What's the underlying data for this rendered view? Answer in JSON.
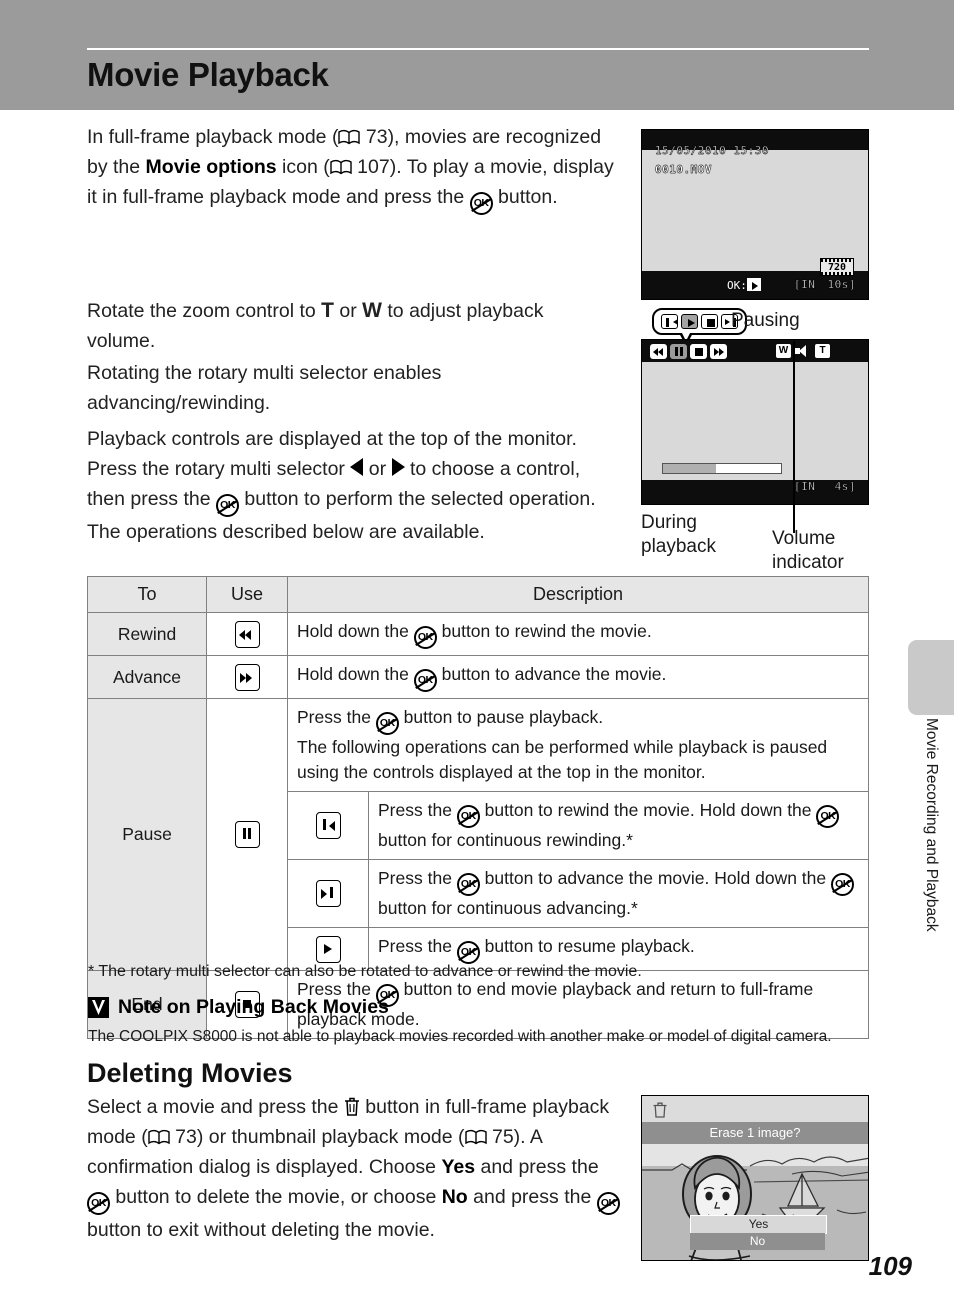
{
  "header": {
    "title": "Movie Playback"
  },
  "body": {
    "para_1_pre": "In full-frame playback mode (",
    "para_1_ref1": "73",
    "para_1_mid1": "), movies are recognized by the ",
    "para_1_bold": "Movie options",
    "para_1_mid2": " icon (",
    "para_1_ref2": "107",
    "para_1_mid3": "). To play a movie, display it in full-frame playback mode and press the ",
    "para_1_end": " button.",
    "para_2_a": "Rotate the zoom control to ",
    "para_2_t": "T",
    "para_2_b": " or ",
    "para_2_w": "W",
    "para_2_c": " to adjust playback volume.",
    "para_3": "Rotating the rotary multi selector enables advancing/rewinding.",
    "para_4_a": "Playback controls are displayed at the top of the monitor. Press the rotary multi selector ",
    "para_4_b": " or ",
    "para_4_c": " to choose a control, then press the ",
    "para_4_d": " button to perform the selected operation. The operations described below are available."
  },
  "screens": {
    "fullframe": {
      "datetime": "15/05/2010 15:30",
      "filename": "0010.MOV",
      "quality_badge": "720",
      "ok_label": "OK:",
      "memory": "[IN",
      "duration": "10s]"
    },
    "playing": {
      "memory": "[IN",
      "duration": "4s]",
      "zoom_wide": "W",
      "zoom_tele": "T",
      "progress_percent": 45,
      "controls": [
        "rewind",
        "pause",
        "stop",
        "advance"
      ]
    },
    "callout": {
      "label": "Pausing",
      "controls": [
        "step-rewind",
        "play",
        "stop",
        "step-advance"
      ]
    },
    "captions": {
      "during_playback": "During playback",
      "volume_indicator": "Volume indicator"
    },
    "erase_dialog": {
      "title": "Erase 1 image?",
      "yes": "Yes",
      "no": "No"
    }
  },
  "table": {
    "headers": [
      "To",
      "Use",
      "Description"
    ],
    "rows": [
      {
        "to": "Rewind",
        "icon": "rewind-icon",
        "desc_a": "Hold down the ",
        "desc_b": " button to rewind the movie."
      },
      {
        "to": "Advance",
        "icon": "advance-icon",
        "desc_a": "Hold down the ",
        "desc_b": " button to advance the movie."
      },
      {
        "to": "Pause",
        "icon": "pause-icon",
        "desc_line1_a": "Press the ",
        "desc_line1_b": " button to pause playback.",
        "desc_line2": "The following operations can be performed while playback is paused using the controls displayed at the top in the monitor.",
        "sub_rows": [
          {
            "icon": "step-rewind-icon",
            "a": "Press the ",
            "b": " button to rewind the movie. Hold down the ",
            "c": " button for continuous rewinding.*"
          },
          {
            "icon": "step-advance-icon",
            "a": "Press the ",
            "b": " button to advance the movie. Hold down the ",
            "c": " button for continuous advancing.*"
          },
          {
            "icon": "play-icon",
            "a": "Press the ",
            "b": " button to resume playback.",
            "c": ""
          }
        ]
      },
      {
        "to": "End",
        "icon": "stop-icon",
        "desc_a": "Press the ",
        "desc_b": " button to end movie playback and return to full-frame playback mode."
      }
    ]
  },
  "footnote": "*   The rotary multi selector can also be rotated to advance or rewind the movie.",
  "note": {
    "heading": "Note on Playing Back Movies",
    "body": "The COOLPIX S8000 is not able to playback movies recorded with another make or model of digital camera."
  },
  "section2": {
    "heading": "Deleting Movies",
    "p_a": "Select a movie and press the ",
    "p_b": " button in full-frame playback mode (",
    "p_ref1": "73",
    "p_c": ") or thumbnail playback mode (",
    "p_ref2": "75",
    "p_d": "). A confirmation dialog is displayed. Choose ",
    "p_yes": "Yes",
    "p_e": " and press the ",
    "p_f": " button to delete the movie, or choose ",
    "p_no": "No",
    "p_g": " and press the ",
    "p_h": " button to exit without deleting the movie."
  },
  "sidebar": {
    "chapter": "Movie Recording and Playback"
  },
  "page_number": "109"
}
